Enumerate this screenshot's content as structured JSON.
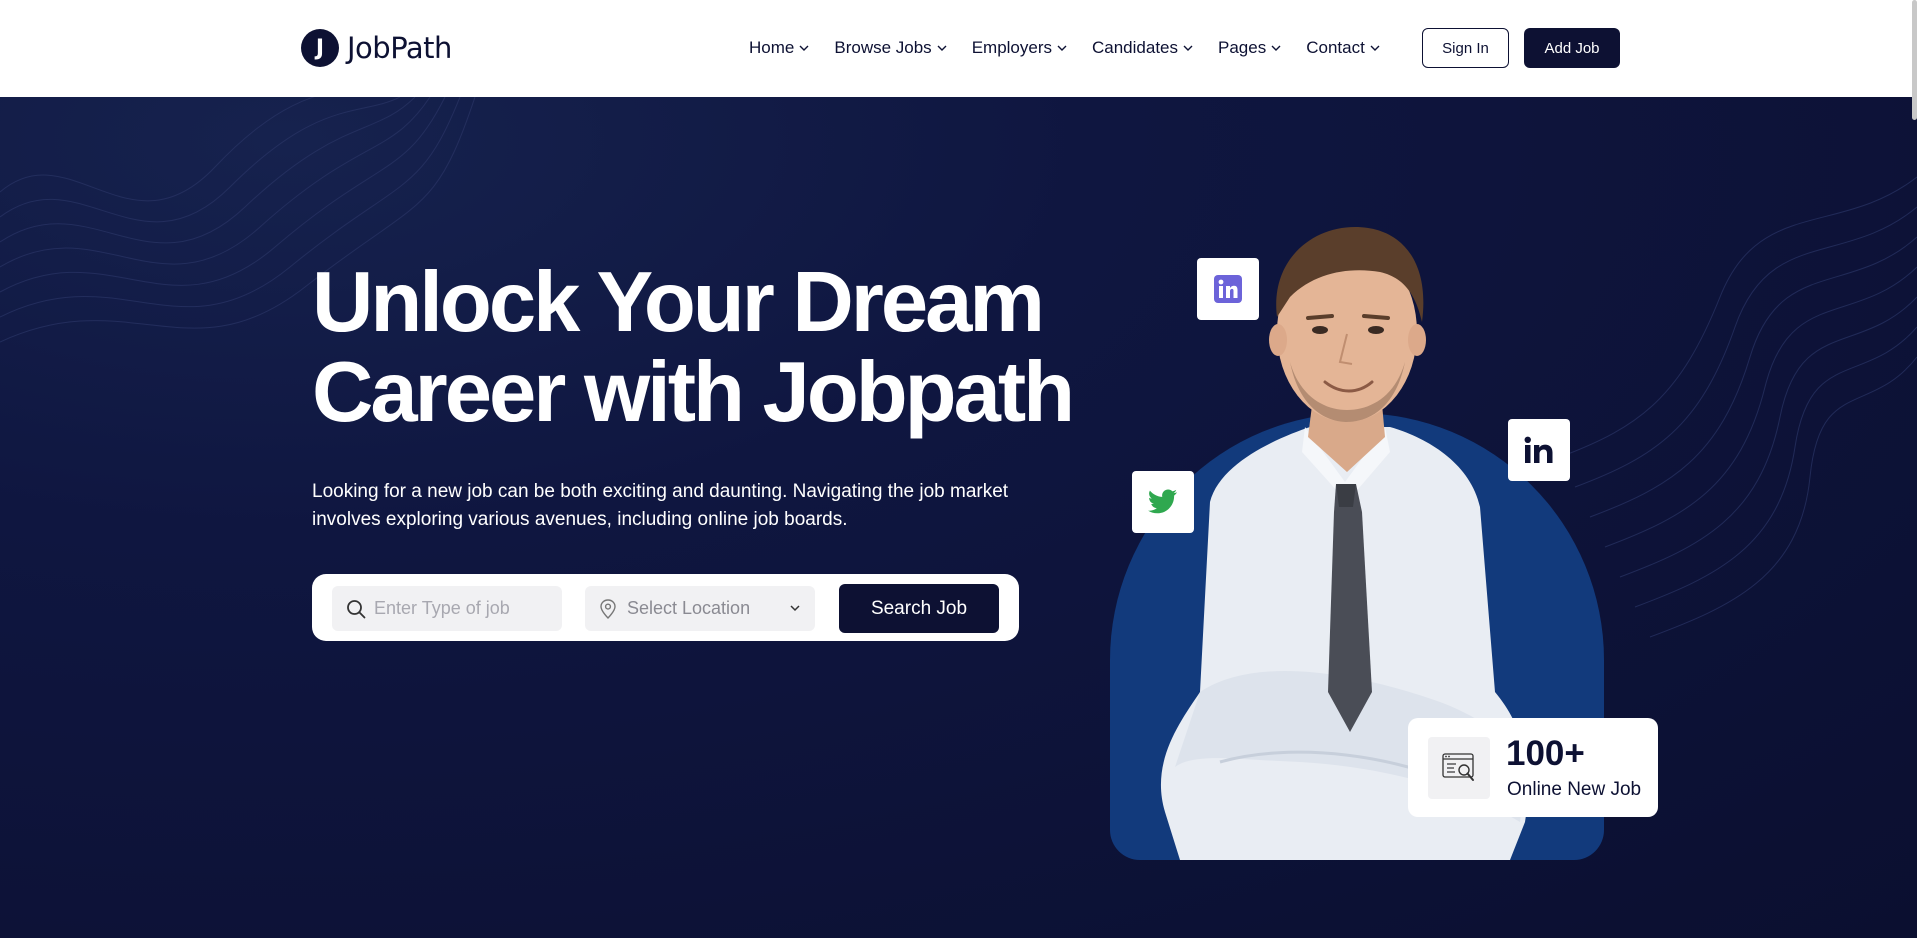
{
  "brand": {
    "logo_letter": "J",
    "name": "JobPath"
  },
  "nav": {
    "items": [
      {
        "label": "Home"
      },
      {
        "label": "Browse Jobs"
      },
      {
        "label": "Employers"
      },
      {
        "label": "Candidates"
      },
      {
        "label": "Pages"
      },
      {
        "label": "Contact"
      }
    ]
  },
  "header": {
    "signin_label": "Sign In",
    "addjob_label": "Add Job"
  },
  "hero": {
    "headline_line1": "Unlock Your Dream",
    "headline_line2": "Career with Jobpath",
    "subtext": "Looking for a new job can be both exciting and daunting. Navigating the job market involves exploring various avenues, including online job boards."
  },
  "search": {
    "job_placeholder": "Enter Type of job",
    "location_value": "Select Location",
    "button_label": "Search Job"
  },
  "stat": {
    "value": "100+",
    "label": "Online New Job"
  },
  "colors": {
    "navy": "#0d1133",
    "arch_blue": "#123a7c",
    "linkedin_purple": "#6c63d9",
    "twitter_green": "#2fa84f"
  },
  "icons": {
    "social": [
      "linkedin-icon",
      "twitter-icon",
      "linkedin-icon"
    ],
    "stat": "job-search-icon"
  }
}
